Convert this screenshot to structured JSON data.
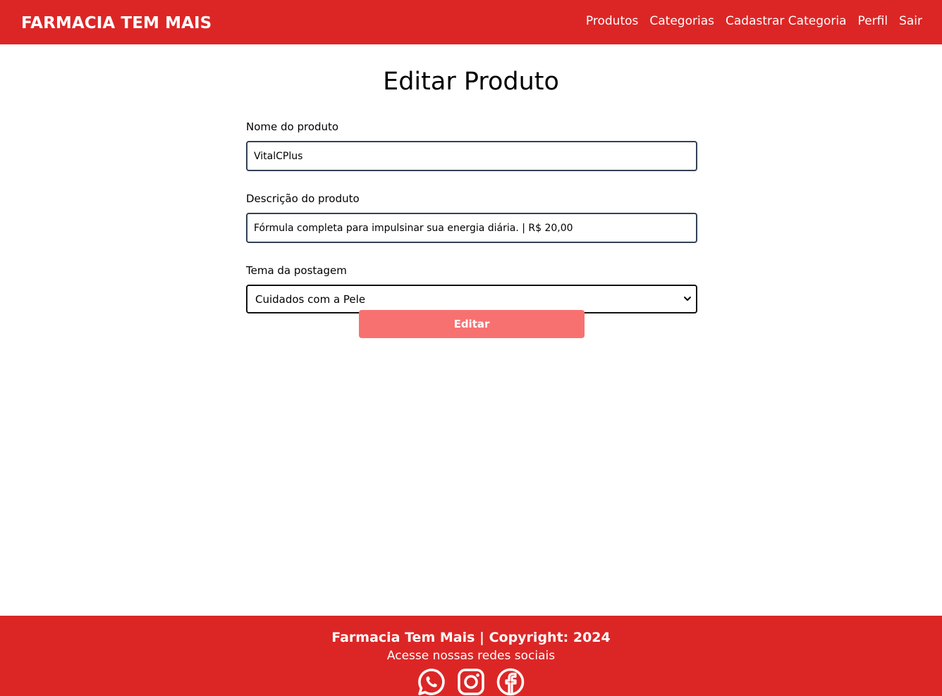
{
  "navbar": {
    "brand": "FARMACIA TEM MAIS",
    "links": [
      "Produtos",
      "Categorias",
      "Cadastrar Categoria",
      "Perfil",
      "Sair"
    ],
    "background": "#dc2626"
  },
  "page": {
    "title": "Editar Produto"
  },
  "form": {
    "name_label": "Nome do produto",
    "name_value": "VitalCPlus",
    "description_label": "Descrição do produto",
    "description_value": "Fórmula completa para impulsinar sua energia diária. | R$ 20,00",
    "theme_label": "Tema da postagem",
    "theme_selected": "Cuidados com a Pele",
    "submit_label": "Editar",
    "submit_color": "#f87171"
  },
  "footer": {
    "copyright": "Farmacia Tem Mais | Copyright: 2024",
    "subtitle": "Acesse nossas redes sociais",
    "social_icons": [
      "whatsapp-icon",
      "instagram-icon",
      "facebook-icon"
    ]
  }
}
